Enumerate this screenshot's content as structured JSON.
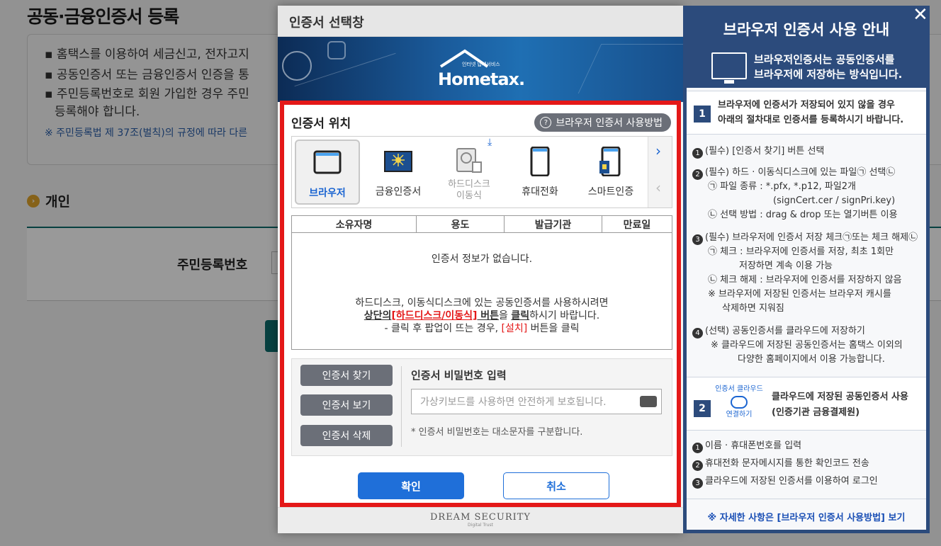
{
  "background_page": {
    "title": "공동·금융인증서 등록",
    "notice_lines": [
      "▪ 홈택스를 이용하여 세금신고, 전자고지",
      "▪ 공동인증서 또는 금융인증서 인증을 통",
      "▪ 주민등록번호로 회원 가입한 경우 주민"
    ],
    "notice_line_cont": "등록해야 합니다.",
    "notice_ref": "※ 주민등록법 제 37조(벌칙)의 규정에 따라 다른",
    "section_title": "개인",
    "field_label": "주민등록번호"
  },
  "modal": {
    "title": "인증서 선택창",
    "logo_subtitle": "인터넷 납세서비스",
    "logo_text": "Hometax.",
    "cert_location_title": "인증서 위치",
    "howto_button": "브라우저 인증서 사용방법",
    "locations": [
      {
        "label": "브라우저",
        "icon": "browser-icon",
        "selected": true
      },
      {
        "label": "금융인증서",
        "icon": "financial-cert-icon",
        "selected": false
      },
      {
        "label": "하드디스크\n이동식",
        "icon": "harddisk-icon",
        "selected": false
      },
      {
        "label": "휴대전화",
        "icon": "mobile-phone-icon",
        "selected": false
      },
      {
        "label": "스마트인증",
        "icon": "smart-auth-icon",
        "selected": false
      }
    ],
    "table": {
      "columns": [
        "소유자명",
        "용도",
        "발급기관",
        "만료일"
      ],
      "empty_text": "인증서 정보가 없습니다.",
      "hint_line1": "하드디스크, 이동식디스크에 있는 공동인증서를 사용하시려면",
      "hint_line2_a": "상단의",
      "hint_line2_b": "[하드디스크/이동식]",
      "hint_line2_c": " 버튼",
      "hint_line2_d": "을 ",
      "hint_line2_e": "클릭",
      "hint_line2_f": "하시기 바랍니다.",
      "hint_line3_a": "- 클릭 후 팝업이 뜨는 경우, ",
      "hint_line3_b": "[설치]",
      "hint_line3_c": " 버튼을 클릭"
    },
    "actions": {
      "find": "인증서 찾기",
      "view": "인증서 보기",
      "delete": "인증서 삭제"
    },
    "password": {
      "label": "인증서 비밀번호 입력",
      "placeholder": "가상키보드를 사용하면 안전하게 보호됩니다.",
      "note": "* 인증서 비밀번호는 대소문자를 구분합니다."
    },
    "ok": "확인",
    "cancel": "취소",
    "footer_brand": "DREAM SECURITY",
    "footer_tag": "Digital Trust"
  },
  "guide": {
    "close": "✕",
    "title": "브라우저 인증서 사용 안내",
    "intro_line1": "브라우저인증서는 공동인증서를",
    "intro_line2": "브라우저에 저장하는 방식입니다.",
    "step1": {
      "num": "1",
      "head_line1": "브라우저에 인증서가 저장되어 있지 않을 경우",
      "head_line2": "아래의 절차대로 인증서를 등록하시기 바랍니다.",
      "items": [
        "(필수) [인증서 찾기] 버튼 선택",
        "(필수) 하드 · 이동식디스크에 있는 파일㉠ 선택㉡",
        "㉠ 파일 종류 : *.pfx, *.p12, 파일2개",
        "(signCert.cer / signPri.key)",
        "㉡ 선택 방법 : drag & drop 또는 열기버튼 이용",
        "(필수) 브라우저에 인증서 저장 체크㉠또는 체크 해제㉡",
        "㉠ 체크 : 브라우저에 인증서를 저장, 최초 1회만",
        "저장하면 계속 이용 가능",
        "㉡ 체크 해제 : 브라우저에 인증서를 저장하지 않음",
        "※ 브라우저에 저장된 인증서는 브라우저 캐시를",
        "삭제하면 지워짐",
        "(선택) 공동인증서를 클라우드에 저장하기",
        "※  클라우드에 저장된 공동인증서는 홈택스 이외의",
        "다양한 홈페이지에서 이용 가능합니다."
      ]
    },
    "step2": {
      "num": "2",
      "badge_top": "인증서 클라우드",
      "badge_bottom": "연결하기",
      "head_line1": "클라우드에 저장된 공동인증서 사용",
      "head_line2": "(인증기관 금융결제원)",
      "items": [
        "이름 · 휴대폰번호를 입력",
        "휴대전화 문자메시지를 통한 확인코드 전송",
        "클라우드에 저장된 인증서를 이용하여 로그인"
      ]
    },
    "link": "※ 자세한 사항은 [브라우저 인증서 사용방법] 보기"
  }
}
